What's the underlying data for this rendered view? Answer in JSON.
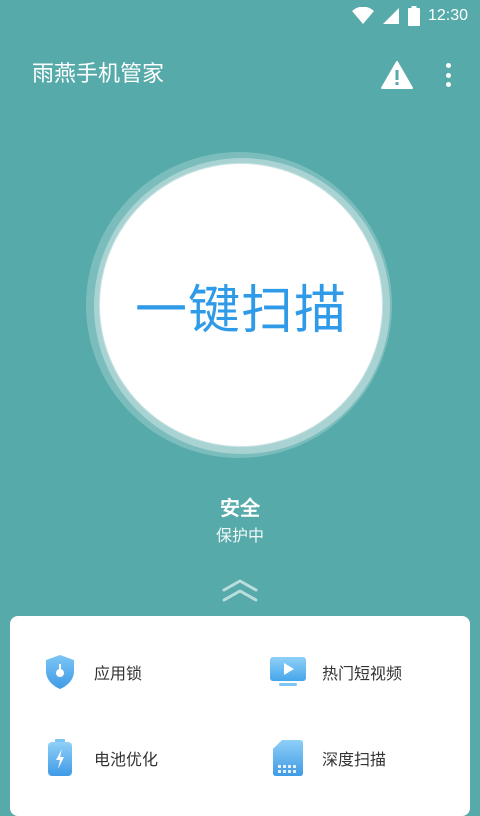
{
  "status_bar": {
    "time": "12:30"
  },
  "app": {
    "title": "雨燕手机管家"
  },
  "scan": {
    "label": "一键扫描"
  },
  "security": {
    "status": "安全",
    "substatus": "保护中"
  },
  "tools": [
    {
      "label": "应用锁",
      "icon": "shield-lock-icon"
    },
    {
      "label": "热门短视频",
      "icon": "video-play-icon"
    },
    {
      "label": "电池优化",
      "icon": "battery-icon"
    },
    {
      "label": "深度扫描",
      "icon": "sd-card-icon"
    }
  ],
  "colors": {
    "background": "#56aaa9",
    "accent": "#2f9be8",
    "panel": "#ffffff"
  }
}
